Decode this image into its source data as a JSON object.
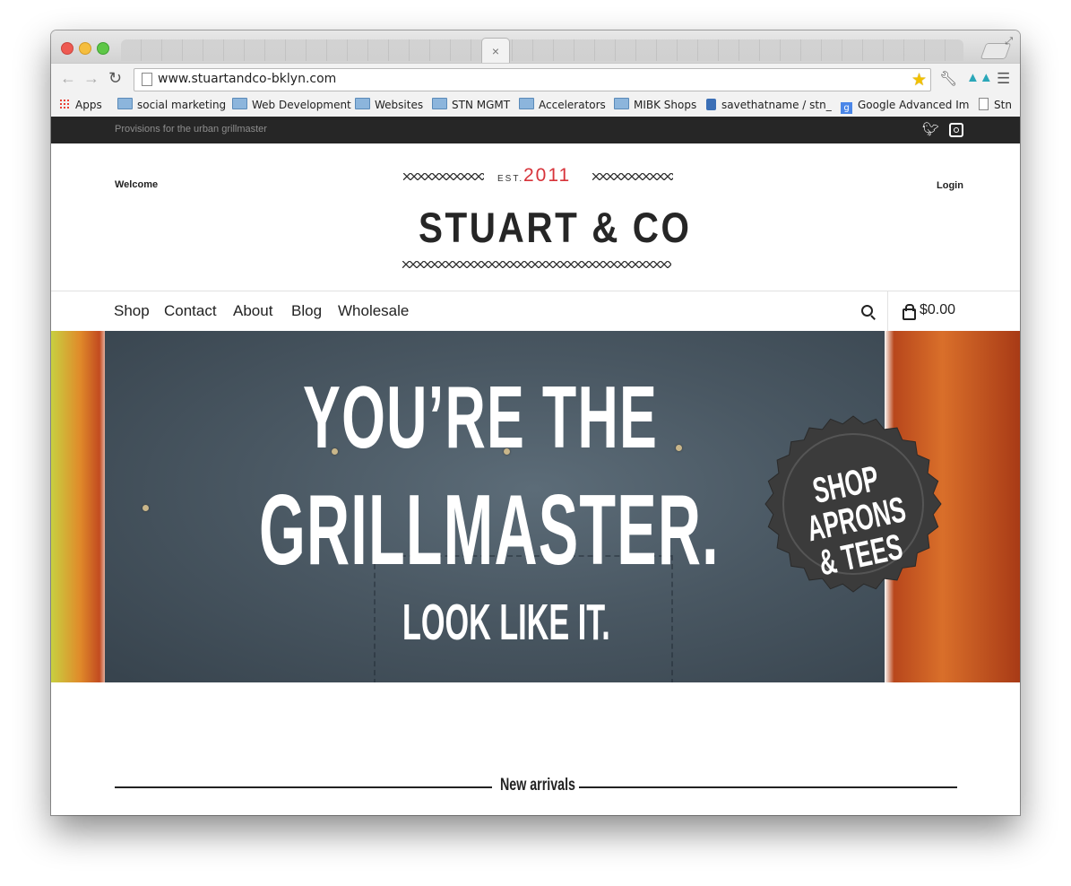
{
  "browser": {
    "url": "www.stuartandco-bklyn.com",
    "tab_close": "×",
    "bookmarks": [
      {
        "label": "Apps",
        "icon": "apps-icon"
      },
      {
        "label": "social marketing",
        "icon": "folder-icon"
      },
      {
        "label": "Web Development",
        "icon": "folder-icon"
      },
      {
        "label": "Websites",
        "icon": "folder-icon"
      },
      {
        "label": "STN MGMT",
        "icon": "folder-icon"
      },
      {
        "label": "Accelerators",
        "icon": "folder-icon"
      },
      {
        "label": "MIBK Shops",
        "icon": "folder-icon"
      },
      {
        "label": "savethatname / stn_",
        "icon": "stack-icon"
      },
      {
        "label": "Google Advanced Im",
        "icon": "google-icon"
      },
      {
        "label": "Stn",
        "icon": "page-icon"
      }
    ]
  },
  "site": {
    "tagline": "Provisions for the urban grillmaster",
    "welcome": "Welcome",
    "login": "Login",
    "est_label": "EST.",
    "est_year": "2011",
    "logo": "STUART & CO",
    "nav": [
      "Shop",
      "Contact",
      "About",
      "Blog",
      "Wholesale"
    ],
    "cart_total": "$0.00",
    "hero": {
      "line1": "YOU’RE THE",
      "line2": "GRILLMASTER.",
      "line3": "LOOK LIKE IT.",
      "seal": [
        "SHOP",
        "APRONS",
        "& TEES"
      ]
    },
    "section_title": "New arrivals"
  },
  "colors": {
    "topbar": "#262626",
    "accent_red": "#d7333a",
    "apron": "#4a5863"
  }
}
